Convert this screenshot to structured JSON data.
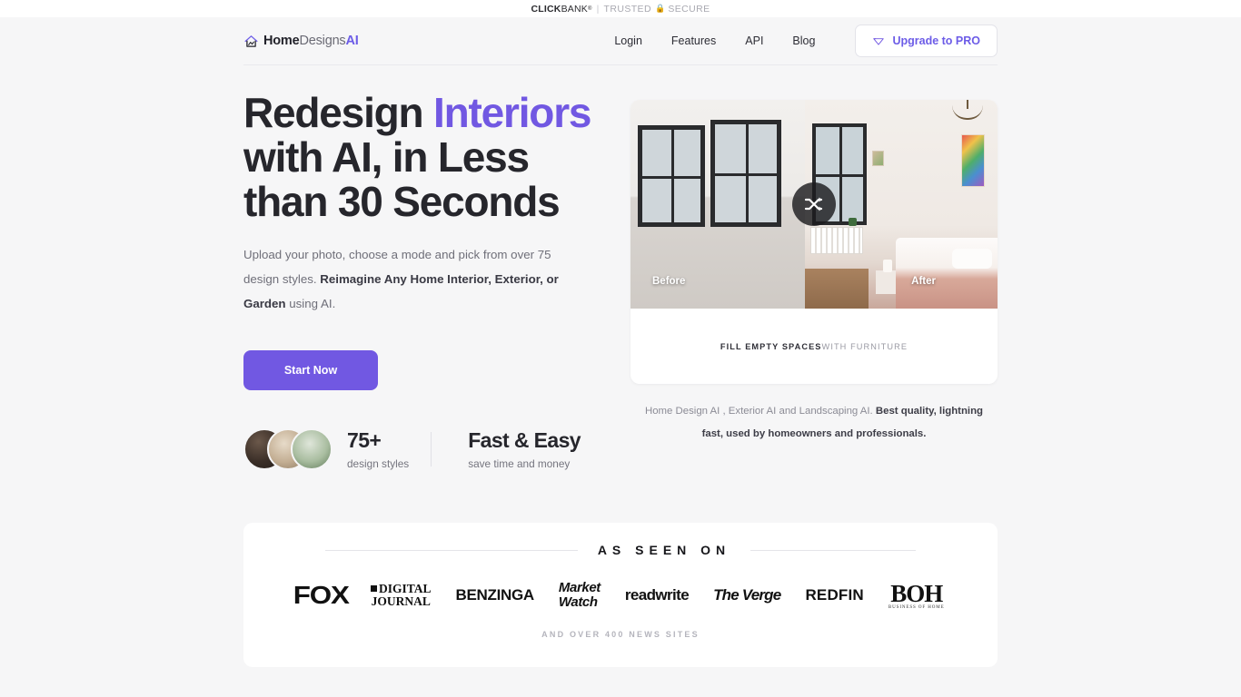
{
  "trustbar": {
    "brand_bold": "CLICK",
    "brand_light": "BANK",
    "registered": "®",
    "separator": "|",
    "trusted": "TRUSTED",
    "lock_icon": "lock-icon",
    "secure": "SECURE"
  },
  "header": {
    "logo": {
      "icon": "house-logo-icon",
      "part1": "Home",
      "part2": "Designs",
      "part3": "AI"
    },
    "nav": [
      {
        "label": "Login"
      },
      {
        "label": "Features"
      },
      {
        "label": "API"
      },
      {
        "label": "Blog"
      }
    ],
    "upgrade": {
      "icon": "gem-icon",
      "label": "Upgrade to PRO"
    }
  },
  "hero": {
    "headline_part1": "Redesign ",
    "headline_accent": "Interiors",
    "headline_part2": " with AI, in Less than 30 Seconds",
    "sub_1": "Upload your photo, choose a mode and pick from over 75 design styles. ",
    "sub_bold": "Reimagine Any Home Interior, Exterior, or Garden",
    "sub_2": " using AI.",
    "cta_label": "Start Now",
    "stats": {
      "avatars": [
        "interior-thumb-dark",
        "interior-thumb-beige",
        "garden-thumb-green"
      ],
      "count": "75+",
      "count_label": "design styles",
      "title": "Fast & Easy",
      "title_label": "save time and money"
    }
  },
  "showcase": {
    "before_label": "Before",
    "after_label": "After",
    "shuffle_icon": "shuffle-icon",
    "caption_bold": "FILL EMPTY SPACES",
    "caption_light": " WITH FURNITURE",
    "note_1": "Home Design AI , Exterior AI and Landscaping AI. ",
    "note_bold": "Best quality, lightning fast, used by homeowners and professionals."
  },
  "as_seen_on": {
    "title": "AS SEEN ON",
    "logos": [
      {
        "name": "fox",
        "text": "FOX"
      },
      {
        "name": "digital-journal",
        "line1": "DIGITAL",
        "line2": "JOURNAL"
      },
      {
        "name": "benzinga",
        "text": "BENZINGA"
      },
      {
        "name": "marketwatch",
        "line1": "Market",
        "line2": "Watch"
      },
      {
        "name": "readwrite",
        "text": "readwrite"
      },
      {
        "name": "the-verge",
        "text": "The Verge"
      },
      {
        "name": "redfin",
        "text": "REDFIN"
      },
      {
        "name": "business-of-home",
        "big": "BOH",
        "small": "BUSINESS OF HOME"
      }
    ],
    "footer": "AND OVER 400 NEWS SITES"
  },
  "colors": {
    "accent_purple": "#7158e2",
    "page_bg": "#f6f6f7",
    "text_dark": "#26262c"
  }
}
